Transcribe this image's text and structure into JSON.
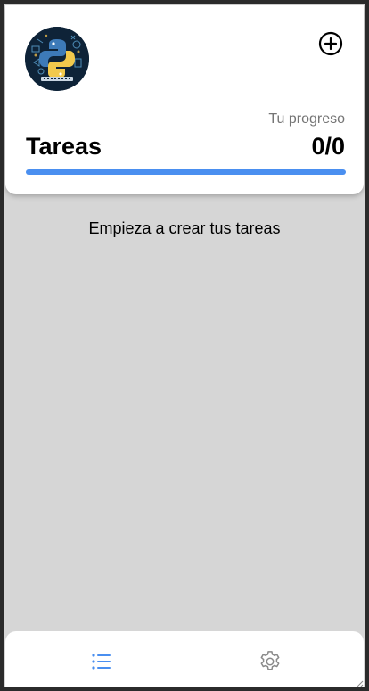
{
  "header": {
    "progress_label": "Tu progreso",
    "title": "Tareas",
    "count": "0/0",
    "progress_fraction": 0
  },
  "main": {
    "empty_message": "Empieza a crear tus tareas"
  },
  "icons": {
    "avatar": "python-logo-avatar",
    "add": "add-circle-icon",
    "tasks": "list-icon",
    "settings": "gear-icon"
  },
  "colors": {
    "accent": "#4a8ff0",
    "background": "#d6d6d6",
    "card": "#ffffff"
  }
}
